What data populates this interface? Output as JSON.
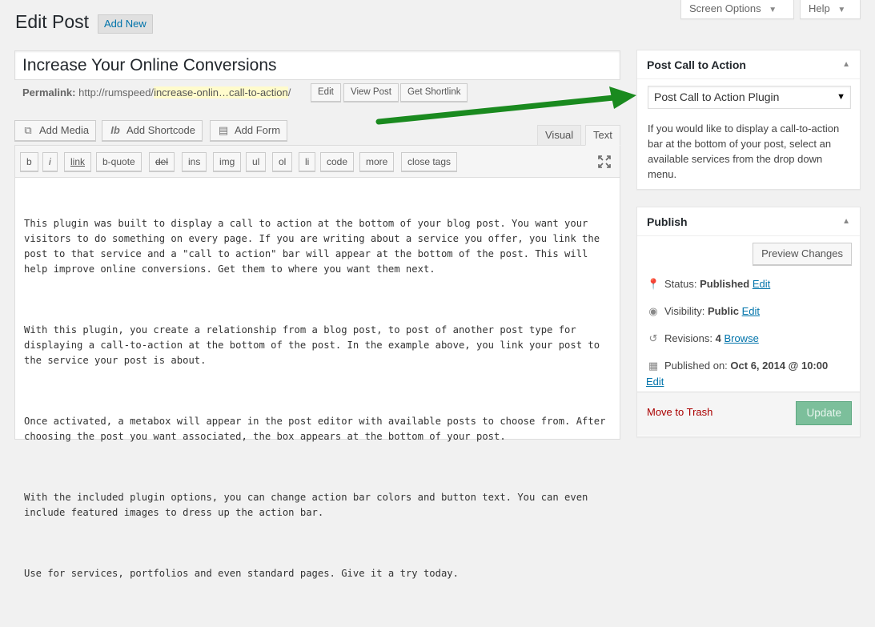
{
  "screen_meta": {
    "screen_options": "Screen Options",
    "help": "Help"
  },
  "heading": {
    "title": "Edit Post",
    "add_new": "Add New"
  },
  "post": {
    "title": "Increase Your Online Conversions",
    "permalink_label": "Permalink:",
    "permalink_base": "http://rumspeed/",
    "permalink_slug": "increase-onlin…call-to-action",
    "permalink_end": "/",
    "edit_btn": "Edit",
    "view_btn": "View Post",
    "shortlink_btn": "Get Shortlink"
  },
  "media": {
    "add_media": "Add Media",
    "add_shortcode": "Add Shortcode",
    "add_form": "Add Form"
  },
  "editor_tabs": {
    "visual": "Visual",
    "text": "Text"
  },
  "quicktags": [
    "b",
    "i",
    "link",
    "b-quote",
    "del",
    "ins",
    "img",
    "ul",
    "ol",
    "li",
    "code",
    "more",
    "close tags"
  ],
  "content": {
    "p1": "This plugin was built to display a call to action at the bottom of your blog post. You want your visitors to do something on every page. If you are writing about a service you offer, you link the post to that service and a \"call to action\" bar will appear at the bottom of the post. This will help improve online conversions. Get them to where you want them next.",
    "p2": "With this plugin, you create a relationship from a blog post, to post of another post type for displaying a call-to-action at the bottom of the post. In the example above, you link your post to the service your post is about.",
    "p3": "Once activated, a metabox will appear in the post editor with available posts to choose from. After choosing the post you want associated, the box appears at the bottom of your post.",
    "p4": "With the included plugin options, you can change action bar colors and button text. You can even include featured images to dress up the action bar.",
    "p5": "Use for services, portfolios and even standard pages. Give it a try today."
  },
  "cta_box": {
    "title": "Post Call to Action",
    "selected": "Post Call to Action Plugin",
    "description": "If you would like to display a call-to-action bar at the bottom of your post, select an available services from the drop down menu."
  },
  "publish_box": {
    "title": "Publish",
    "preview": "Preview Changes",
    "status_label": "Status:",
    "status_value": "Published",
    "visibility_label": "Visibility:",
    "visibility_value": "Public",
    "revisions_label": "Revisions:",
    "revisions_value": "4",
    "browse": "Browse",
    "published_label": "Published on:",
    "published_value": "Oct 6, 2014 @ 10:00",
    "edit": "Edit",
    "trash": "Move to Trash",
    "update": "Update"
  },
  "icons": {
    "toggle": "triangle-up-icon",
    "status": "pin-icon",
    "visibility": "eye-icon",
    "revisions": "history-icon",
    "calendar": "calendar-icon",
    "media": "media-icon",
    "shortcode": "shortcode-icon",
    "form": "form-icon",
    "fullscreen": "fullscreen-icon",
    "annotation": "green-arrow-icon"
  },
  "colors": {
    "link": "#0073aa",
    "arrow": "#1a8a1f",
    "trash": "#aa0000",
    "update": "#7cbf9b",
    "slug_highlight": "#fffbcc"
  }
}
